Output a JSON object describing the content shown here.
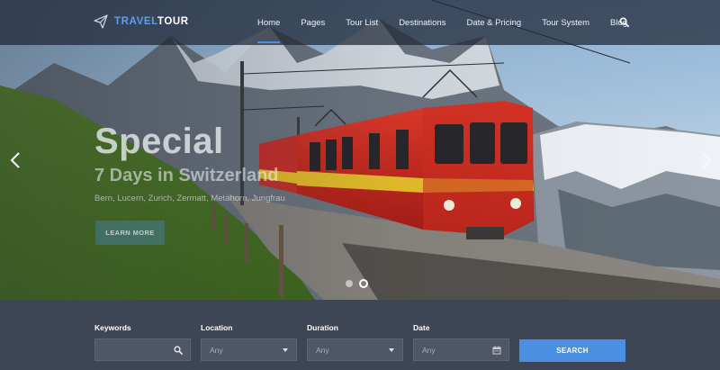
{
  "header": {
    "logo_part1": "TRAVEL",
    "logo_part2": "TOUR",
    "logo_icon": "paper-plane-icon",
    "nav": [
      {
        "label": "Home",
        "active": true
      },
      {
        "label": "Pages"
      },
      {
        "label": "Tour List"
      },
      {
        "label": "Destinations"
      },
      {
        "label": "Date & Pricing"
      },
      {
        "label": "Tour System"
      },
      {
        "label": "Blog"
      }
    ],
    "search_icon": "search-icon"
  },
  "slider": {
    "title": "Special",
    "subtitle": "7 Days in Switzerland",
    "description": "Bern, Lucern, Zurich, Zermatt, Metahorn, Jungfrau",
    "button_label": "LEARN MORE",
    "prev_icon": "chevron-left-icon",
    "next_icon": "chevron-right-icon",
    "dot_count": 2,
    "active_dot": 2
  },
  "search": {
    "keywords_label": "Keywords",
    "keywords_value": "",
    "location_label": "Location",
    "location_value": "Any",
    "duration_label": "Duration",
    "duration_value": "Any",
    "date_label": "Date",
    "date_value": "Any",
    "button_label": "SEARCH"
  },
  "colors": {
    "accent": "#4a90e2",
    "header_bg": "#1e2634",
    "search_bar_bg": "#3e4554",
    "field_bg": "#4f5665"
  }
}
